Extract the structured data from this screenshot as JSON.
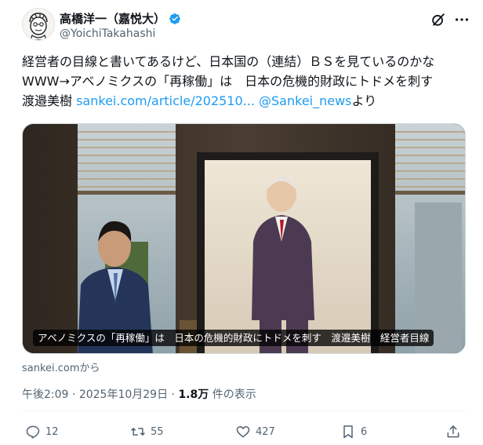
{
  "author": {
    "display_name": "高橋洋一（嘉悦大）",
    "handle": "@YoichiTakahashi",
    "avatar_icon": "caricature-avatar-icon",
    "verified_icon": "verified-badge-icon",
    "verified_color": "#1d9bf0"
  },
  "tweet": {
    "line1": "経営者の目線と書いてあるけど、日本国の（連結）ＢＳを見ているのかな",
    "line2": "WWW→アベノミクスの「再稼働」は　日本の危機的財政にトドメを刺す",
    "line3_text": "渡邉美樹 ",
    "line3_link": "sankei.com/article/202510...",
    "line3_mention": "@Sankei_news",
    "line3_suffix": "より",
    "link_color": "#1d9bf0"
  },
  "card": {
    "caption": "アベノミクスの「再稼働」は　日本の危機的財政にトドメを刺す　渡邉美樹　経営者目線",
    "source": "sankei.comから"
  },
  "meta": {
    "time": "午後2:09",
    "sep1": " · ",
    "date": "2025年10月29日",
    "sep2": " · ",
    "views": "1.8万",
    "views_suffix": " 件の表示"
  },
  "actions": {
    "reply_count": "12",
    "repost_count": "55",
    "like_count": "427",
    "bookmark_count": "6",
    "reply_icon": "reply-icon",
    "repost_icon": "repost-icon",
    "like_icon": "heart-icon",
    "bookmark_icon": "bookmark-icon",
    "share_icon": "share-icon"
  }
}
